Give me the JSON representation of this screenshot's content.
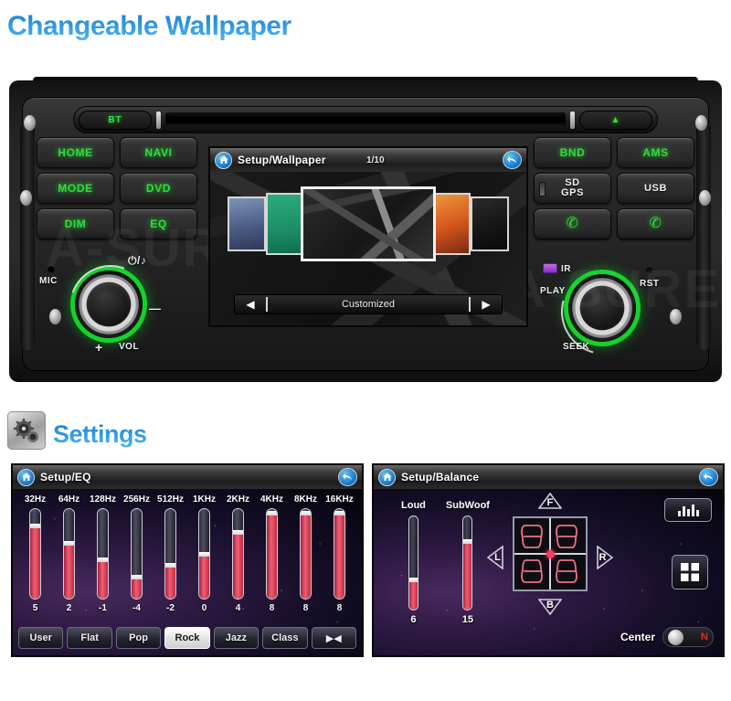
{
  "headings": {
    "main_title": "Changeable Wallpaper",
    "settings_title": "Settings",
    "settings_icon": "gear-icon"
  },
  "stereo_unit": {
    "disc_slot": {
      "bt_label": "BT",
      "eject_label": "▲"
    },
    "left_panel": {
      "buttons": [
        {
          "label": "HOME",
          "style": "green"
        },
        {
          "label": "NAVI",
          "style": "green"
        },
        {
          "label": "MODE",
          "style": "green"
        },
        {
          "label": "DVD",
          "style": "green"
        },
        {
          "label": "DIM",
          "style": "green"
        },
        {
          "label": "EQ",
          "style": "green"
        }
      ],
      "mic_label": "MIC",
      "power_label": "⏻/♪",
      "minus_label": "—",
      "plus_label": "+",
      "vol_label": "VOL"
    },
    "right_panel": {
      "buttons": [
        {
          "label": "BND",
          "style": "green"
        },
        {
          "label": "AMS",
          "style": "green"
        },
        {
          "label": "SD GPS",
          "style": "white"
        },
        {
          "label": "USB",
          "style": "white"
        },
        {
          "label": "✆",
          "style": "green"
        },
        {
          "label": "✆",
          "style": "green"
        }
      ],
      "ir_label": "IR",
      "rst_label": "RST",
      "play_label": "PLAY",
      "seek_label": "SEEK"
    },
    "watermark": "A-SURE"
  },
  "wallpaper_screen": {
    "title": "Setup/Wallpaper",
    "counter": "1/10",
    "home_icon": "home-icon",
    "back_icon": "back-arrow-icon",
    "prev_label": "◀",
    "next_label": "▶",
    "source_name": "Customized",
    "thumbnails": [
      {
        "name": "wallpaper-blue",
        "color": "#4b5d85",
        "selected": false
      },
      {
        "name": "wallpaper-green",
        "color": "#1c8e66",
        "selected": false
      },
      {
        "name": "wallpaper-geometric",
        "color": "#2c2c2c",
        "selected": true
      },
      {
        "name": "wallpaper-orange",
        "color": "#d2541c",
        "selected": false
      },
      {
        "name": "wallpaper-dark",
        "color": "#141414",
        "selected": false
      }
    ]
  },
  "eq_screen": {
    "title": "Setup/EQ",
    "home_icon": "home-icon",
    "back_icon": "back-arrow-icon",
    "presets": [
      {
        "label": "User",
        "active": false
      },
      {
        "label": "Flat",
        "active": false
      },
      {
        "label": "Pop",
        "active": false
      },
      {
        "label": "Rock",
        "active": true
      },
      {
        "label": "Jazz",
        "active": false
      },
      {
        "label": "Class",
        "active": false
      },
      {
        "label": "▶◀",
        "active": false
      }
    ],
    "chart_data": {
      "type": "bar",
      "title": "Setup/EQ",
      "xlabel": "",
      "ylabel": "",
      "categories": [
        "32Hz",
        "64Hz",
        "128Hz",
        "256Hz",
        "512Hz",
        "1KHz",
        "2KHz",
        "4KHz",
        "8KHz",
        "16KHz"
      ],
      "values": [
        5,
        2,
        -1,
        -4,
        -2,
        0,
        4,
        8,
        8,
        8
      ],
      "ylim": [
        -8,
        8
      ],
      "grid": false,
      "legend": "none"
    }
  },
  "balance_screen": {
    "title": "Setup/Balance",
    "home_icon": "home-icon",
    "back_icon": "back-arrow-icon",
    "sliders": [
      {
        "label": "Loud",
        "value": "6",
        "percent": 32
      },
      {
        "label": "SubWoof",
        "value": "15",
        "percent": 74
      }
    ],
    "directions": {
      "front": "F",
      "back": "B",
      "left": "L",
      "right": "R"
    },
    "icon_buttons": [
      {
        "name": "equalizer-bars-icon",
        "label": "▆█▄█"
      },
      {
        "name": "four-pane-grid-icon",
        "label": "⊞"
      }
    ],
    "center": {
      "label": "Center",
      "state": "N"
    },
    "chart_data": {
      "type": "bar",
      "title": "Setup/Balance",
      "categories": [
        "Loud",
        "SubWoof"
      ],
      "values": [
        6,
        15
      ],
      "ylim": [
        0,
        20
      ],
      "xlabel": "",
      "ylabel": "",
      "grid": false
    }
  }
}
